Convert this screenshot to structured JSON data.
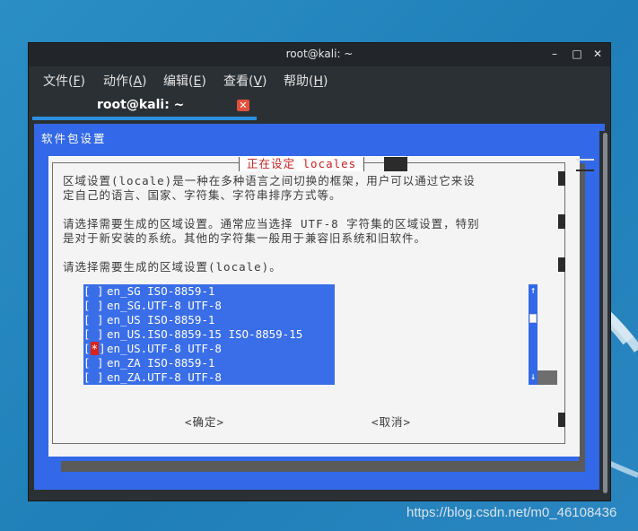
{
  "window": {
    "title": "root@kali: ~",
    "controls": {
      "minimize": "–",
      "maximize": "□",
      "close": "✕"
    }
  },
  "menubar": {
    "items": [
      {
        "label": "文件(",
        "key": "F",
        "suffix": ")"
      },
      {
        "label": "动作(",
        "key": "A",
        "suffix": ")"
      },
      {
        "label": "编辑(",
        "key": "E",
        "suffix": ")"
      },
      {
        "label": "查看(",
        "key": "V",
        "suffix": ")"
      },
      {
        "label": "帮助(",
        "key": "H",
        "suffix": ")"
      }
    ]
  },
  "tab": {
    "label": "root@kali: ~",
    "close": "✕"
  },
  "terminal": {
    "header": "软件包设置",
    "dialog": {
      "title": "正在设定 locales",
      "desc1_line1": "区域设置(locale)是一种在多种语言之间切换的框架，用户可以通过它来设",
      "desc1_line2": "定自己的语言、国家、字符集、字符串排序方式等。",
      "desc2_line1": "请选择需要生成的区域设置。通常应当选择 UTF-8 字符集的区域设置，特别",
      "desc2_line2": "是对于新安装的系统。其他的字符集一般用于兼容旧系统和旧软件。",
      "prompt": "请选择需要生成的区域设置(locale)。",
      "locales": [
        {
          "checked": false,
          "name": "en_SG ISO-8859-1"
        },
        {
          "checked": false,
          "name": "en_SG.UTF-8 UTF-8"
        },
        {
          "checked": false,
          "name": "en_US ISO-8859-1"
        },
        {
          "checked": false,
          "name": "en_US.ISO-8859-15 ISO-8859-15"
        },
        {
          "checked": true,
          "name": "en_US.UTF-8 UTF-8"
        },
        {
          "checked": false,
          "name": "en_ZA ISO-8859-1"
        },
        {
          "checked": false,
          "name": "en_ZA.UTF-8 UTF-8"
        }
      ],
      "scroll_up": "↑",
      "scroll_down": "↓",
      "ok_button": "<确定>",
      "cancel_button": "<取消>"
    }
  },
  "watermark": "https://blog.csdn.net/m0_46108436",
  "colors": {
    "terminal_bg": "#3369e8",
    "dialog_bg": "#f4f4f4",
    "title_red": "#c4201e",
    "accent": "#2b8fe0"
  }
}
